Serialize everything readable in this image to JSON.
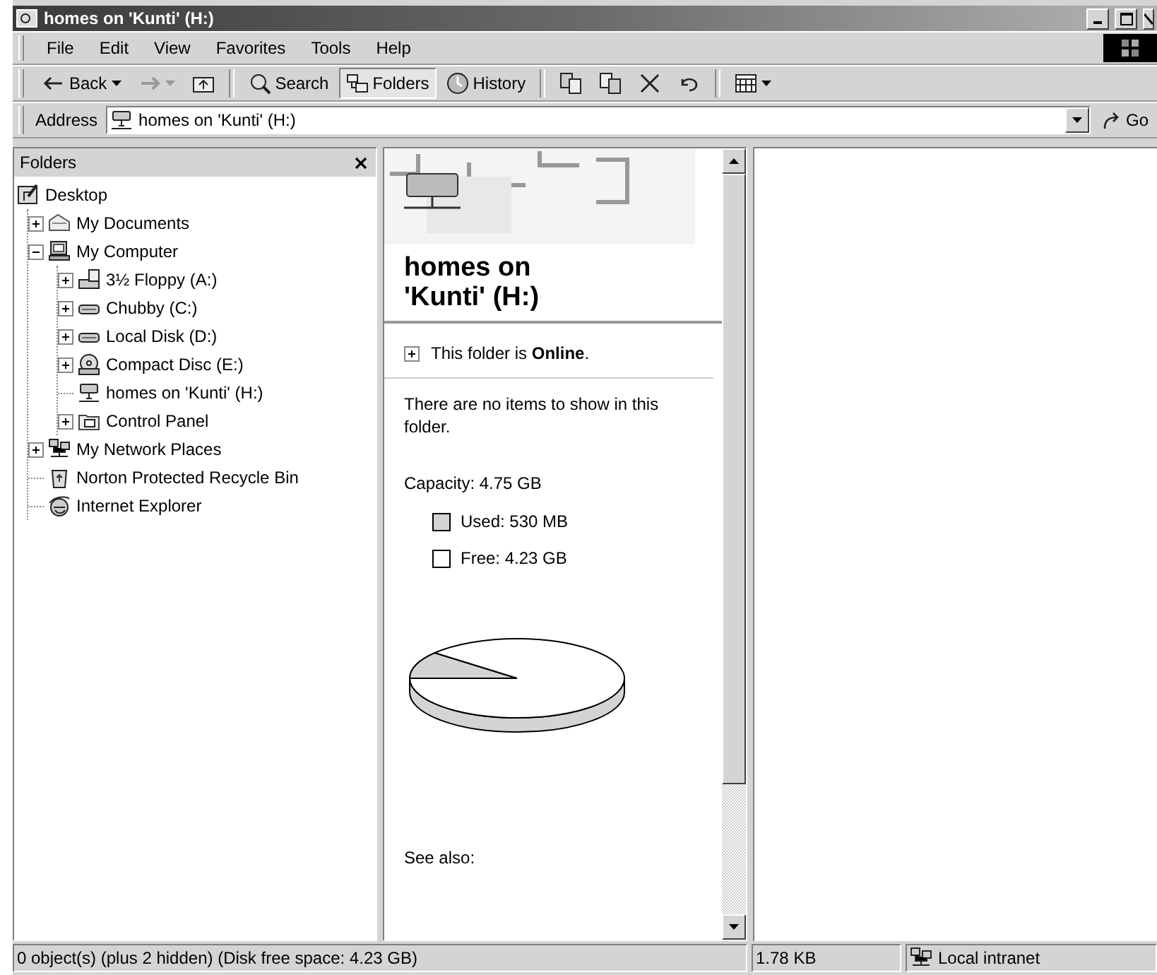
{
  "window": {
    "title": "homes on 'Kunti' (H:)"
  },
  "menu": [
    "File",
    "Edit",
    "View",
    "Favorites",
    "Tools",
    "Help"
  ],
  "toolbar": [
    {
      "kind": "back",
      "label": "Back",
      "disabled": false,
      "pressed": false
    },
    {
      "kind": "forward",
      "disabled": true,
      "pressed": false
    },
    {
      "kind": "up",
      "disabled": false,
      "pressed": false
    },
    {
      "kind": "search",
      "label": "Search",
      "disabled": false,
      "pressed": false
    },
    {
      "kind": "folders",
      "label": "Folders",
      "disabled": false,
      "pressed": true
    },
    {
      "kind": "history",
      "label": "History",
      "disabled": false,
      "pressed": false
    },
    {
      "kind": "move",
      "disabled": false,
      "pressed": false
    },
    {
      "kind": "copy",
      "disabled": false,
      "pressed": false
    },
    {
      "kind": "delete",
      "disabled": false,
      "pressed": false
    },
    {
      "kind": "undo",
      "disabled": false,
      "pressed": false
    },
    {
      "kind": "views",
      "disabled": false,
      "pressed": false
    }
  ],
  "address": {
    "label": "Address",
    "value": "homes on 'Kunti' (H:)",
    "go": "Go"
  },
  "folders_pane": {
    "title": "Folders",
    "tree": [
      {
        "label": "Desktop",
        "kind": "desktop",
        "children": [
          {
            "label": "My Documents",
            "kind": "documents",
            "expanded": false
          },
          {
            "label": "My Computer",
            "kind": "computer",
            "expanded": true,
            "children": [
              {
                "label": "3½ Floppy (A:)",
                "kind": "floppy",
                "expanded": false
              },
              {
                "label": "Chubby (C:)",
                "kind": "drive",
                "expanded": false
              },
              {
                "label": "Local Disk (D:)",
                "kind": "drive",
                "expanded": false
              },
              {
                "label": "Compact Disc (E:)",
                "kind": "cd",
                "expanded": false
              },
              {
                "label": "homes on 'Kunti' (H:)",
                "kind": "netdrive",
                "selected": false
              },
              {
                "label": "Control Panel",
                "kind": "control",
                "expanded": false
              }
            ]
          },
          {
            "label": "My Network Places",
            "kind": "network",
            "expanded": false
          },
          {
            "label": "Norton Protected Recycle Bin",
            "kind": "recycle"
          },
          {
            "label": "Internet Explorer",
            "kind": "ie"
          }
        ]
      }
    ]
  },
  "info_pane": {
    "heading": "homes on\n'Kunti' (H:)",
    "status": {
      "text": "This folder is **Online**.",
      "expanded": false
    },
    "message": "There are no items to show in this folder.",
    "capacity": "Capacity: 4.75 GB",
    "legend": [
      {
        "label": "Used: 530 MB",
        "color": "#d4d4d4"
      },
      {
        "label": "Free: 4.23 GB",
        "color": "#ffffff"
      }
    ],
    "see_also": "See also:"
  },
  "status_bar": [
    "0 object(s) (plus 2 hidden) (Disk free space: 4.23 GB)",
    "1.78 KB",
    "Local intranet"
  ]
}
